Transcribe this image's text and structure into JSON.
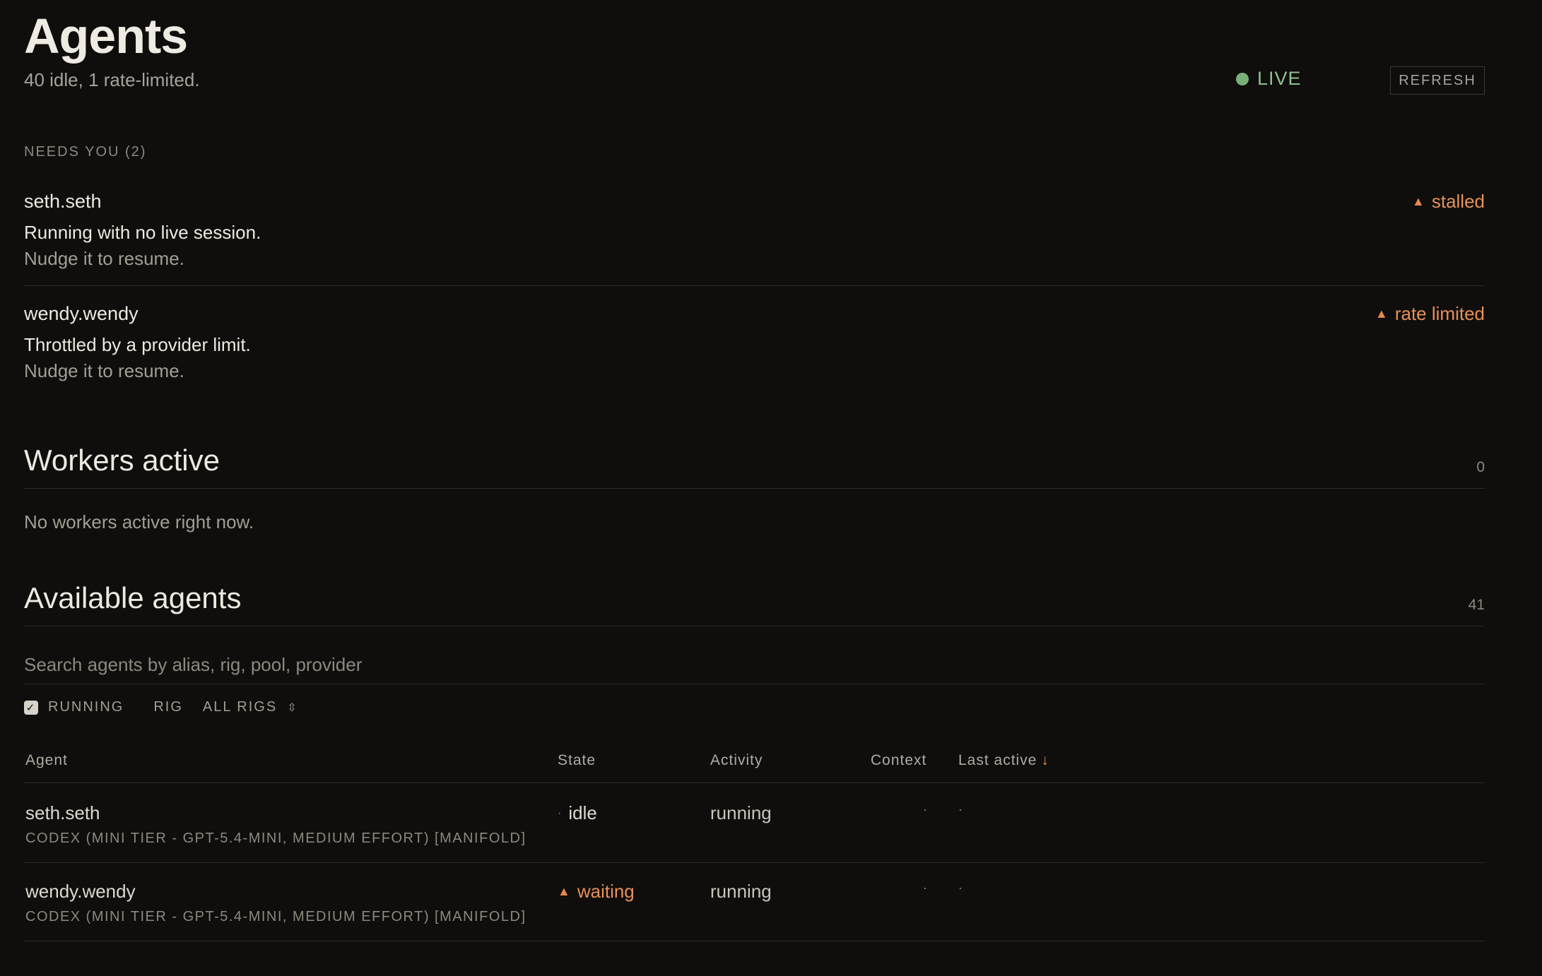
{
  "header": {
    "title": "Agents",
    "subtitle": "40 idle, 1 rate-limited.",
    "live_label": "LIVE",
    "refresh_label": "REFRESH"
  },
  "needs_you": {
    "label": "NEEDS YOU (2)",
    "items": [
      {
        "name": "seth.seth",
        "description": "Running with no live session.",
        "hint": "Nudge it to resume.",
        "badge": "stalled"
      },
      {
        "name": "wendy.wendy",
        "description": "Throttled by a provider limit.",
        "hint": "Nudge it to resume.",
        "badge": "rate limited"
      }
    ]
  },
  "workers": {
    "title": "Workers active",
    "count": "0",
    "empty_text": "No workers active right now."
  },
  "available": {
    "title": "Available agents",
    "count": "41",
    "search_placeholder": "Search agents by alias, rig, pool, provider",
    "filter_running": "RUNNING",
    "filter_rig_label": "RIG",
    "filter_rig_value": "ALL RIGS",
    "columns": {
      "agent": "Agent",
      "state": "State",
      "activity": "Activity",
      "context": "Context",
      "last_active": "Last active"
    },
    "rows": [
      {
        "name": "seth.seth",
        "model": "CODEX (MINI TIER - GPT-5.4-MINI, MEDIUM EFFORT) [MANIFOLD]",
        "state": "idle",
        "activity": "running",
        "context": "·",
        "last_active": "·"
      },
      {
        "name": "wendy.wendy",
        "model": "CODEX (MINI TIER - GPT-5.4-MINI, MEDIUM EFFORT) [MANIFOLD]",
        "state": "waiting",
        "activity": "running",
        "context": "·",
        "last_active": "·"
      }
    ]
  },
  "colors": {
    "background": "#0f0e0c",
    "live": "#8fbf8e",
    "warning": "#e89058"
  }
}
